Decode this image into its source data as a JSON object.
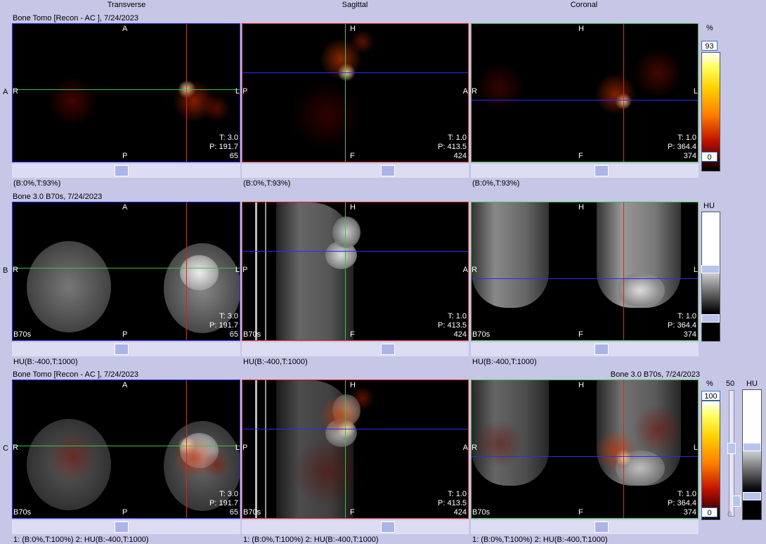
{
  "columns": [
    "Transverse",
    "Sagittal",
    "Coronal"
  ],
  "rows": [
    {
      "label": "A",
      "title_left": "Bone Tomo [Recon - AC ], 7/24/2023",
      "title_right": "",
      "modality": "spect",
      "views": [
        {
          "top": "A",
          "bottom": "P",
          "left": "R",
          "right": "L",
          "t": "T: 3.0",
          "p": "P: 191.7",
          "n": "65",
          "corner": ""
        },
        {
          "top": "H",
          "bottom": "F",
          "left": "P",
          "right": "A",
          "t": "T: 1.0",
          "p": "P: 413.5",
          "n": "424",
          "corner": ""
        },
        {
          "top": "H",
          "bottom": "F",
          "left": "R",
          "right": "L",
          "t": "T: 1.0",
          "p": "P: 364.4",
          "n": "374",
          "corner": ""
        }
      ],
      "window_labels": [
        "(B:0%,T:93%)",
        "(B:0%,T:93%)",
        "(B:0%,T:93%)"
      ],
      "colorbar": {
        "unit": "%",
        "top_value": "93",
        "bottom_value": "0"
      }
    },
    {
      "label": "B",
      "title_left": "Bone  3.0  B70s, 7/24/2023",
      "title_right": "",
      "modality": "ct",
      "views": [
        {
          "top": "A",
          "bottom": "P",
          "left": "R",
          "right": "L",
          "t": "T: 3.0",
          "p": "P: 191.7",
          "n": "65",
          "corner": "B70s"
        },
        {
          "top": "H",
          "bottom": "F",
          "left": "P",
          "right": "A",
          "t": "T: 1.0",
          "p": "P: 413.5",
          "n": "424",
          "corner": "B70s"
        },
        {
          "top": "H",
          "bottom": "F",
          "left": "R",
          "right": "L",
          "t": "T: 1.0",
          "p": "P: 364.4",
          "n": "374",
          "corner": "B70s"
        }
      ],
      "window_labels": [
        "HU(B:-400,T:1000)",
        "HU(B:-400,T:1000)",
        "HU(B:-400,T:1000)"
      ],
      "colorbar": {
        "unit": "HU"
      }
    },
    {
      "label": "C",
      "title_left": "Bone Tomo [Recon - AC ], 7/24/2023",
      "title_right": "Bone  3.0  B70s, 7/24/2023",
      "modality": "fused",
      "views": [
        {
          "top": "A",
          "bottom": "P",
          "left": "R",
          "right": "L",
          "t": "T: 3.0",
          "p": "P: 191.7",
          "n": "65",
          "corner": "B70s"
        },
        {
          "top": "H",
          "bottom": "F",
          "left": "P",
          "right": "A",
          "t": "T: 1.0",
          "p": "P: 413.5",
          "n": "424",
          "corner": "B70s"
        },
        {
          "top": "H",
          "bottom": "F",
          "left": "R",
          "right": "L",
          "t": "T: 1.0",
          "p": "P: 364.4",
          "n": "374",
          "corner": "B70s"
        }
      ],
      "window_labels": [
        "1: (B:0%,T:100%)    2: HU(B:-400,T:1000)",
        "1: (B:0%,T:100%)    2: HU(B:-400,T:1000)",
        "1: (B:0%,T:100%)    2: HU(B:-400,T:1000)"
      ],
      "colorbar": {
        "unit": "%",
        "top_value": "100",
        "bottom_value": "0",
        "blend_value": "50",
        "blend_bottom": "0",
        "ct_unit": "HU"
      }
    }
  ],
  "colors": {
    "crosshair_red": "#e02020",
    "crosshair_green": "#3fbf3f",
    "crosshair_blue": "#2a2aff",
    "background": "#c6c6e6"
  }
}
